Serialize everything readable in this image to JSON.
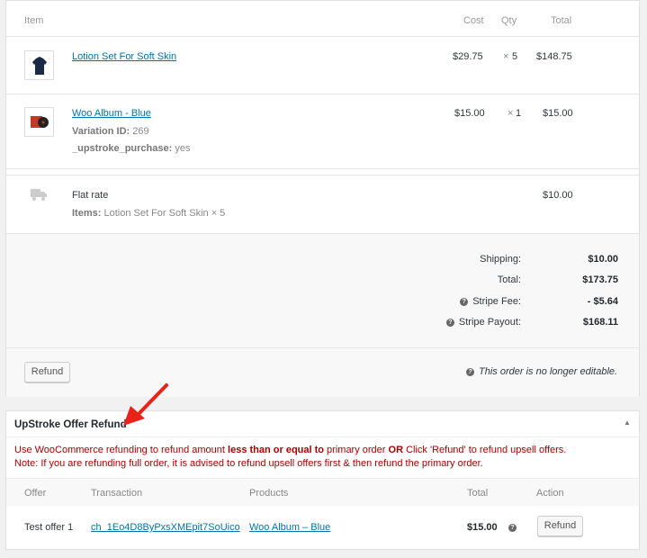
{
  "items_table": {
    "headers": {
      "item": "Item",
      "cost": "Cost",
      "qty": "Qty",
      "total": "Total"
    },
    "line_items": [
      {
        "name": "Lotion Set For Soft Skin",
        "cost": "$29.75",
        "qty_symbol": "×",
        "qty": "5",
        "total": "$148.75",
        "thumb_color": "#1b2a44"
      },
      {
        "name": "Woo Album - Blue",
        "meta1_label": "Variation ID:",
        "meta1_value": "269",
        "meta2_label": "_upstroke_purchase:",
        "meta2_value": "yes",
        "cost": "$15.00",
        "qty_symbol": "×",
        "qty": "1",
        "total": "$15.00",
        "thumb_color": "#c0392b"
      }
    ],
    "shipping": {
      "name": "Flat rate",
      "items_label": "Items:",
      "items_value": "Lotion Set For Soft Skin × 5",
      "total": "$10.00"
    }
  },
  "totals": {
    "shipping_label": "Shipping:",
    "shipping_value": "$10.00",
    "total_label": "Total:",
    "total_value": "$173.75",
    "stripe_fee_label": "Stripe Fee:",
    "stripe_fee_value": "- $5.64",
    "stripe_payout_label": "Stripe Payout:",
    "stripe_payout_value": "$168.11"
  },
  "actions": {
    "refund_label": "Refund",
    "not_editable": "This order is no longer editable."
  },
  "offer_refund": {
    "title": "UpStroke Offer Refund",
    "notice1_a": "Use WooCommerce refunding to refund amount ",
    "notice1_b": "less than or equal to",
    "notice1_c": " primary order ",
    "notice1_d": "OR",
    "notice1_e": " Click 'Refund' to refund upsell offers.",
    "notice2": "Note: If you are refunding full order, it is advised to refund upsell offers first & then refund the primary order.",
    "headers": {
      "offer": "Offer",
      "transaction": "Transaction",
      "products": "Products",
      "total": "Total",
      "action": "Action"
    },
    "row": {
      "offer": "Test offer 1",
      "transaction": "ch_1Eo4D8ByPxsXMEpit7SoUico",
      "product": "Woo Album – Blue",
      "total": "$15.00",
      "action": "Refund"
    }
  }
}
